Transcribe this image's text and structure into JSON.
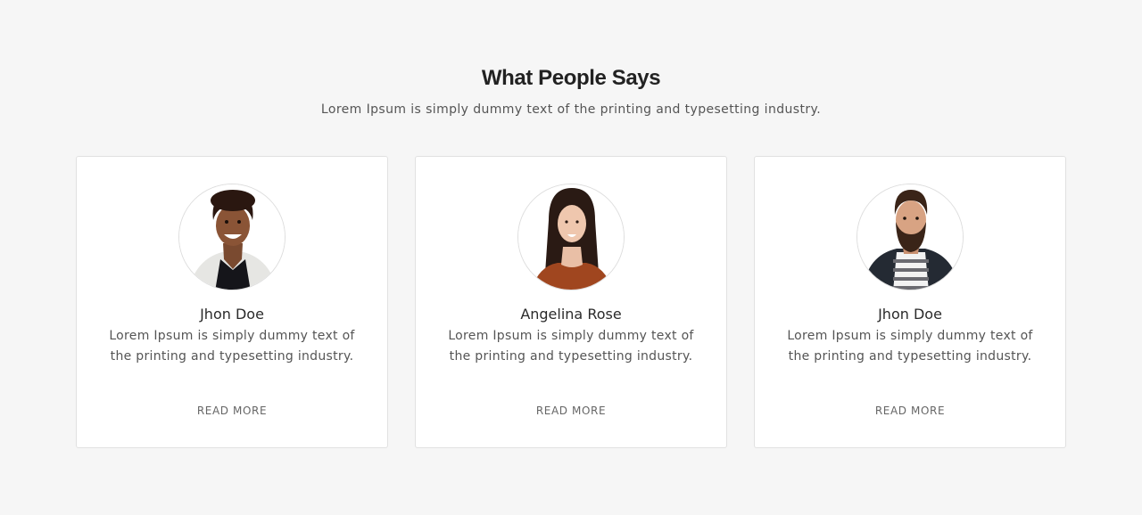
{
  "heading": {
    "title": "What People Says",
    "subtitle": "Lorem Ipsum is simply dummy text of the printing and typesetting industry."
  },
  "testimonials": [
    {
      "name": "Jhon Doe",
      "quote": "Lorem Ipsum is simply dummy text of the printing and typesetting industry.",
      "link_label": "READ MORE",
      "avatar": "man-afro-photo"
    },
    {
      "name": "Angelina Rose",
      "quote": "Lorem Ipsum is simply dummy text of the printing and typesetting industry.",
      "link_label": "READ MORE",
      "avatar": "woman-photo"
    },
    {
      "name": "Jhon Doe",
      "quote": "Lorem Ipsum is simply dummy text of the printing and typesetting industry.",
      "link_label": "READ MORE",
      "avatar": "bearded-man-photo"
    }
  ],
  "colors": {
    "background": "#f6f6f6",
    "card": "#ffffff",
    "card_border": "#e1e1e1",
    "heading": "#222222",
    "body_text": "#555555"
  }
}
